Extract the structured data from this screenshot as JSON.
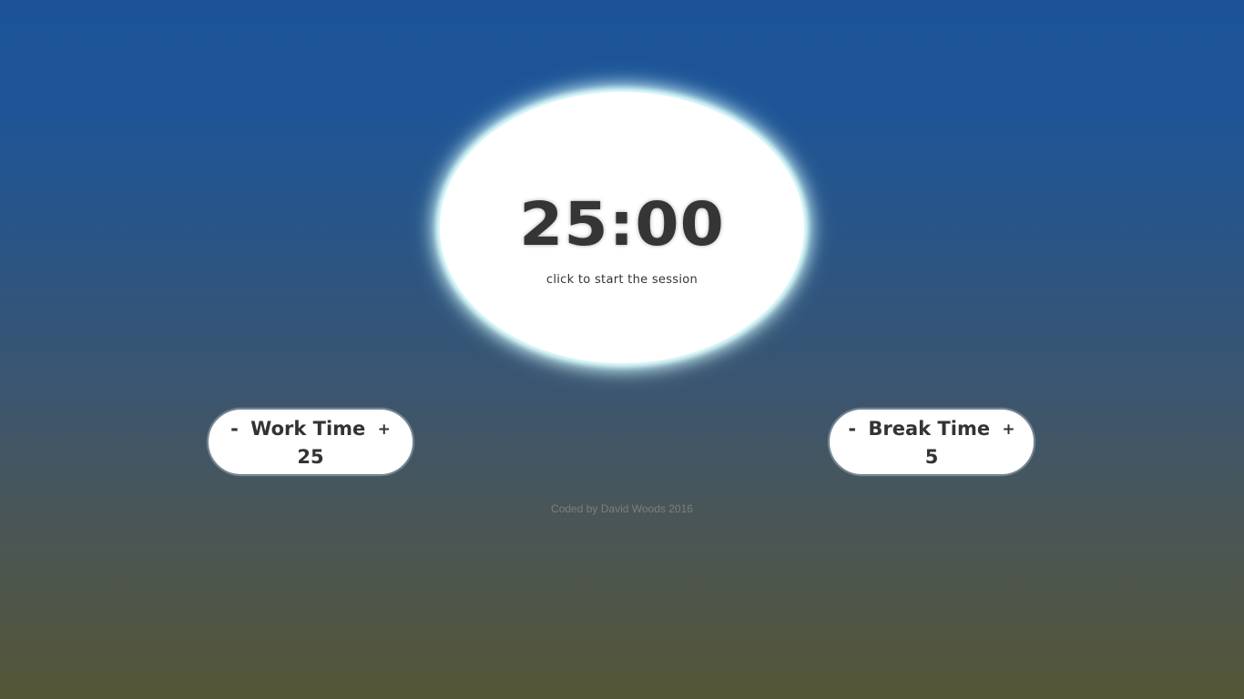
{
  "timer": {
    "time": "25:00",
    "hint": "click to start the session"
  },
  "work_setting": {
    "minus": "-",
    "label": "Work Time",
    "plus": "+",
    "value": "25"
  },
  "break_setting": {
    "minus": "-",
    "label": "Break Time",
    "plus": "+",
    "value": "5"
  },
  "footer": {
    "credit": "Coded by David Woods 2016"
  },
  "colors": {
    "background_top": "#1c5398",
    "background_bottom": "#555638",
    "circle_glow": "#dffdfd",
    "text": "#333333"
  }
}
